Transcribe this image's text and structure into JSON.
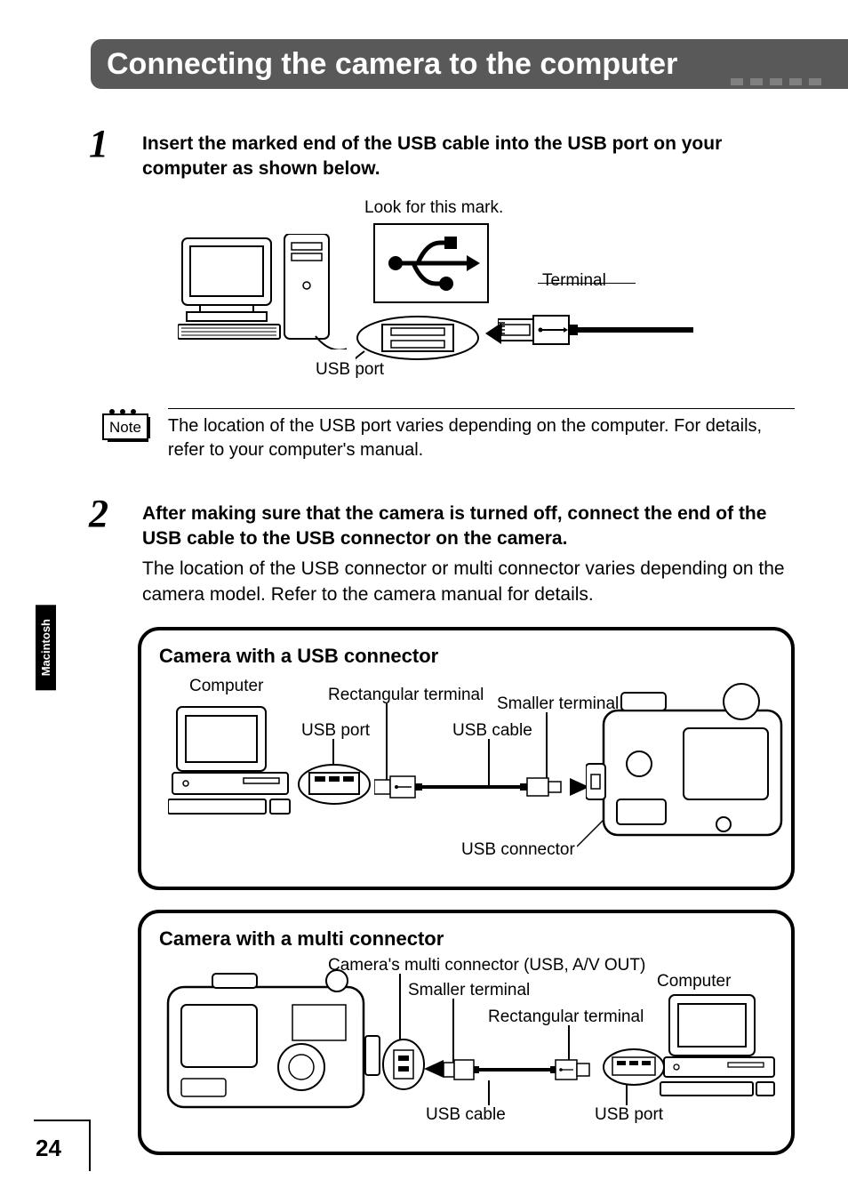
{
  "header": {
    "title": "Connecting the camera to the computer"
  },
  "side_tab": "Macintosh",
  "page_number": "24",
  "steps": {
    "step1": {
      "num": "1",
      "bold": "Insert the marked end of the USB cable into the USB port on your computer as shown below."
    },
    "step2": {
      "num": "2",
      "bold": "After making sure that the camera is turned off, connect the end of the USB cable to the USB connector on the camera.",
      "plain": "The location of the USB connector or multi connector varies depending on the camera model. Refer to the camera manual for details."
    }
  },
  "diagram1": {
    "look_mark": "Look for this mark.",
    "terminal": "Terminal",
    "usb_port": "USB port"
  },
  "note": {
    "label": "Note",
    "text": "The location of the USB port varies depending on the computer. For details, refer to your computer's manual."
  },
  "panel_usb": {
    "title": "Camera with a USB connector",
    "labels": {
      "computer": "Computer",
      "rect_terminal": "Rectangular terminal",
      "smaller_terminal": "Smaller terminal",
      "usb_port": "USB port",
      "usb_cable": "USB cable",
      "usb_connector": "USB connector"
    }
  },
  "panel_multi": {
    "title": "Camera with a multi connector",
    "labels": {
      "multi_connector": "Camera's multi connector (USB, A/V OUT)",
      "smaller_terminal": "Smaller terminal",
      "rect_terminal": "Rectangular terminal",
      "computer": "Computer",
      "usb_cable": "USB cable",
      "usb_port": "USB port"
    }
  }
}
